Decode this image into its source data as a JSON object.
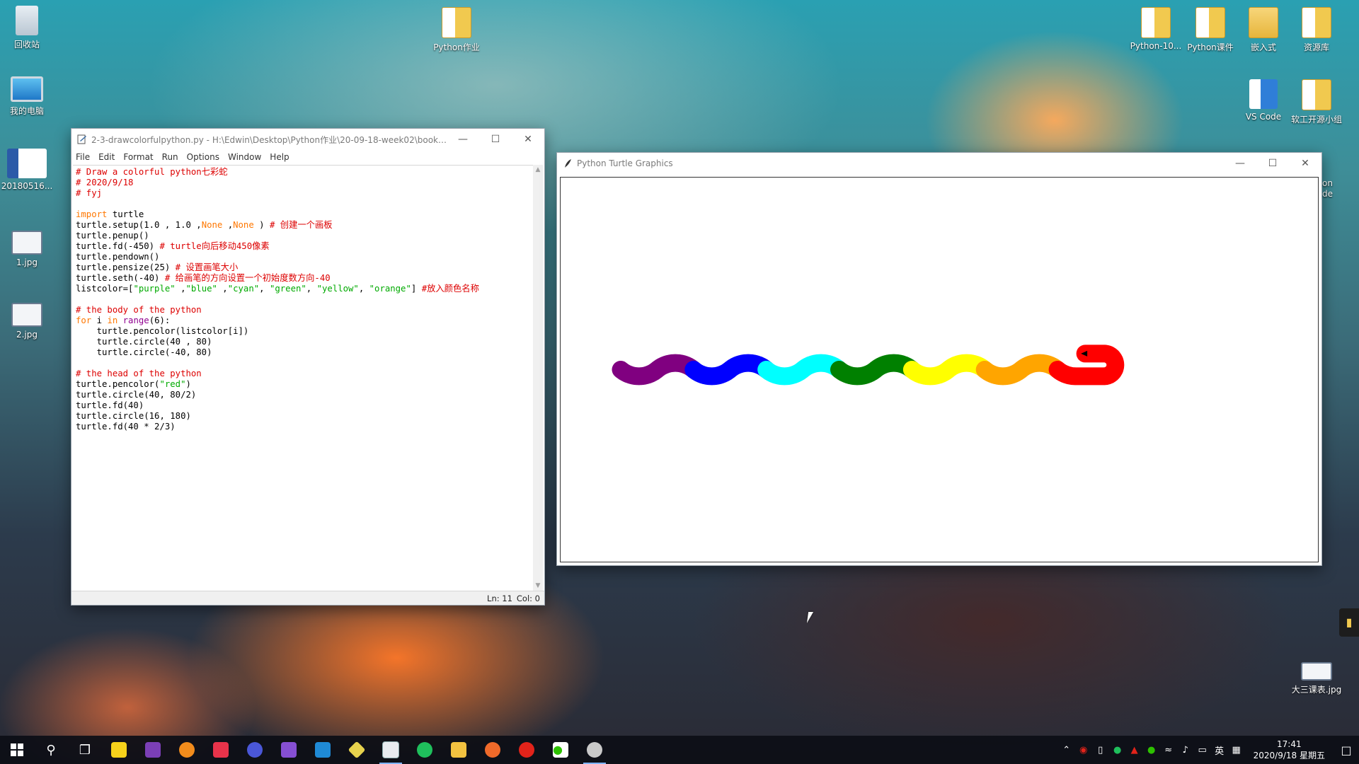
{
  "desktop": {
    "left_icons": [
      {
        "label": "回收站",
        "icon": "recycle-bin-icon"
      },
      {
        "label": "我的电脑",
        "icon": "computer-icon"
      },
      {
        "label": "20180516...",
        "icon": "word-document-icon"
      },
      {
        "label": "1.jpg",
        "icon": "image-file-icon"
      },
      {
        "label": "2.jpg",
        "icon": "image-file-icon"
      }
    ],
    "center_icons": [
      {
        "label": "Python作业",
        "icon": "folder-icon"
      }
    ],
    "right_icons": [
      {
        "label": "Python-10...",
        "icon": "folder-icon"
      },
      {
        "label": "Python课件",
        "icon": "folder-icon"
      },
      {
        "label": "嵌入式",
        "icon": "folder-icon"
      },
      {
        "label": "资源库",
        "icon": "folder-icon"
      },
      {
        "label": "VS Code",
        "icon": "folder-icon"
      },
      {
        "label": "软工开源小组",
        "icon": "folder-icon"
      },
      {
        "label": "大三课表.jpg",
        "icon": "image-file-icon"
      }
    ],
    "partial_label": "on\nde"
  },
  "idle": {
    "title": "2-3-drawcolorfulpython.py - H:\\Edwin\\Desktop\\Python作业\\20-09-18-week02\\book-...",
    "menu": [
      "File",
      "Edit",
      "Format",
      "Run",
      "Options",
      "Window",
      "Help"
    ],
    "status_line": "Ln: 11",
    "status_col": "Col: 0"
  },
  "turtle": {
    "title": "Python Turtle Graphics",
    "snake_colors": [
      "#800080",
      "#0000ff",
      "#00ffff",
      "#008000",
      "#ffff00",
      "#ffa500"
    ],
    "head_color": "#ff0000"
  },
  "taskbar": {
    "tray_lang": "英",
    "clock_time": "17:41",
    "clock_date": "2020/9/18 星期五"
  }
}
